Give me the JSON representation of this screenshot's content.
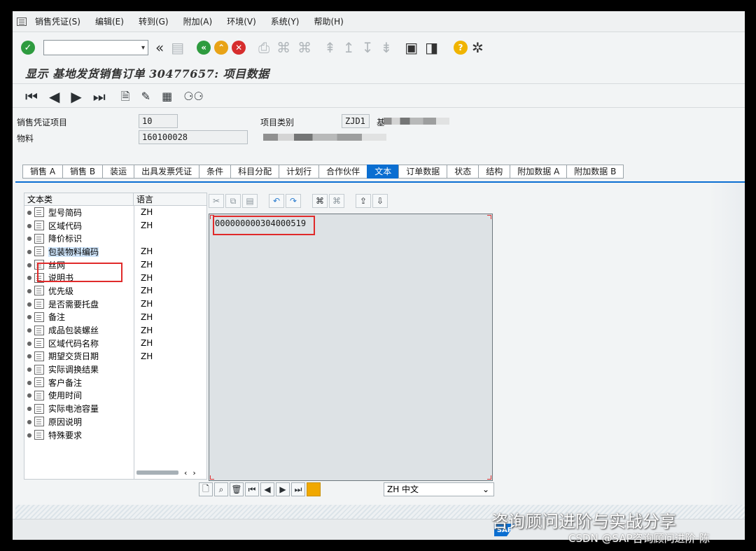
{
  "menu": [
    "销售凭证(S)",
    "编辑(E)",
    "转到(G)",
    "附加(A)",
    "环境(V)",
    "系统(Y)",
    "帮助(H)"
  ],
  "page_title": "显示 基地发货销售订单 30477657: 项目数据",
  "header": {
    "item_label": "销售凭证项目",
    "item_value": "10",
    "category_label": "项目类别",
    "category_value": "ZJD1",
    "category_desc_prefix": "基",
    "material_label": "物料",
    "material_value": "160100028"
  },
  "tabs": [
    "销售 A",
    "销售 B",
    "装运",
    "出具发票凭证",
    "条件",
    "科目分配",
    "计划行",
    "合作伙伴",
    "文本",
    "订单数据",
    "状态",
    "结构",
    "附加数据 A",
    "附加数据 B"
  ],
  "active_tab": "文本",
  "tree": {
    "col_type": "文本类",
    "col_lang": "语言",
    "rows": [
      {
        "name": "型号简码",
        "lang": "ZH"
      },
      {
        "name": "区域代码",
        "lang": "ZH"
      },
      {
        "name": "降价标识",
        "lang": ""
      },
      {
        "name": "包装物料编码",
        "lang": "ZH"
      },
      {
        "name": "丝网",
        "lang": "ZH"
      },
      {
        "name": "说明书",
        "lang": "ZH"
      },
      {
        "name": "优先级",
        "lang": "ZH"
      },
      {
        "name": "是否需要托盘",
        "lang": "ZH"
      },
      {
        "name": "备注",
        "lang": "ZH"
      },
      {
        "name": "成品包装螺丝",
        "lang": "ZH"
      },
      {
        "name": "区域代码名称",
        "lang": "ZH"
      },
      {
        "name": "期望交货日期",
        "lang": "ZH"
      },
      {
        "name": "实际调换结果",
        "lang": ""
      },
      {
        "name": "客户备注",
        "lang": ""
      },
      {
        "name": "使用时间",
        "lang": ""
      },
      {
        "name": "实际电池容量",
        "lang": ""
      },
      {
        "name": "原因说明",
        "lang": ""
      },
      {
        "name": "特殊要求",
        "lang": ""
      }
    ],
    "selected_index": 3
  },
  "editor_text": "000000000304000519",
  "language_select": "ZH 中文",
  "watermark": {
    "line1": "咨询顾问进阶与实战分享",
    "line2": "CSDN @SAP咨询顾问进阶-陈"
  }
}
